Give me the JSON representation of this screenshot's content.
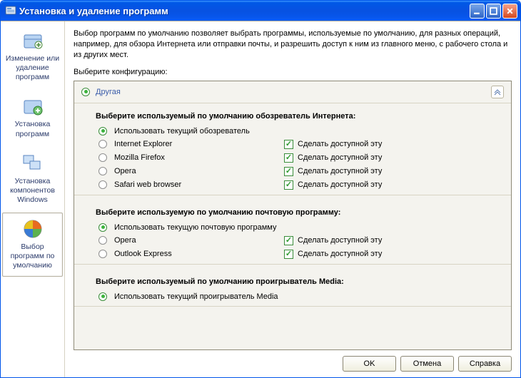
{
  "title": "Установка и удаление программ",
  "sidebar": {
    "items": [
      {
        "label": "Изменение или удаление программ"
      },
      {
        "label": "Установка программ"
      },
      {
        "label": "Установка компонентов Windows"
      },
      {
        "label": "Выбор программ по умолчанию"
      }
    ]
  },
  "intro": "Выбор программ по умолчанию позволяет выбрать программы, используемые по умолчанию, для разных операций, например, для обзора Интернета или отправки почты, и разрешить доступ к ним из главного меню, с рабочего стола и из других мест.",
  "prompt": "Выберите конфигурацию:",
  "config": {
    "category_label": "Другая",
    "access_label": "Сделать доступной эту",
    "sections": [
      {
        "title": "Выберите используемый по умолчанию обозреватель Интернета:",
        "options": [
          {
            "label": "Использовать текущий обозреватель",
            "selected": true,
            "access": null
          },
          {
            "label": "Internet Explorer",
            "selected": false,
            "access": true
          },
          {
            "label": "Mozilla Firefox",
            "selected": false,
            "access": true
          },
          {
            "label": "Opera",
            "selected": false,
            "access": true
          },
          {
            "label": "Safari web browser",
            "selected": false,
            "access": true
          }
        ]
      },
      {
        "title": "Выберите используемую по умолчанию почтовую программу:",
        "options": [
          {
            "label": "Использовать текущую почтовую программу",
            "selected": true,
            "access": null
          },
          {
            "label": "Opera",
            "selected": false,
            "access": true
          },
          {
            "label": "Outlook Express",
            "selected": false,
            "access": true
          }
        ]
      },
      {
        "title": "Выберите используемый по умолчанию проигрыватель Media:",
        "options": [
          {
            "label": "Использовать текущий проигрыватель Media",
            "selected": true,
            "access": null
          }
        ]
      }
    ]
  },
  "buttons": {
    "ok": "OK",
    "cancel": "Отмена",
    "help": "Справка"
  }
}
